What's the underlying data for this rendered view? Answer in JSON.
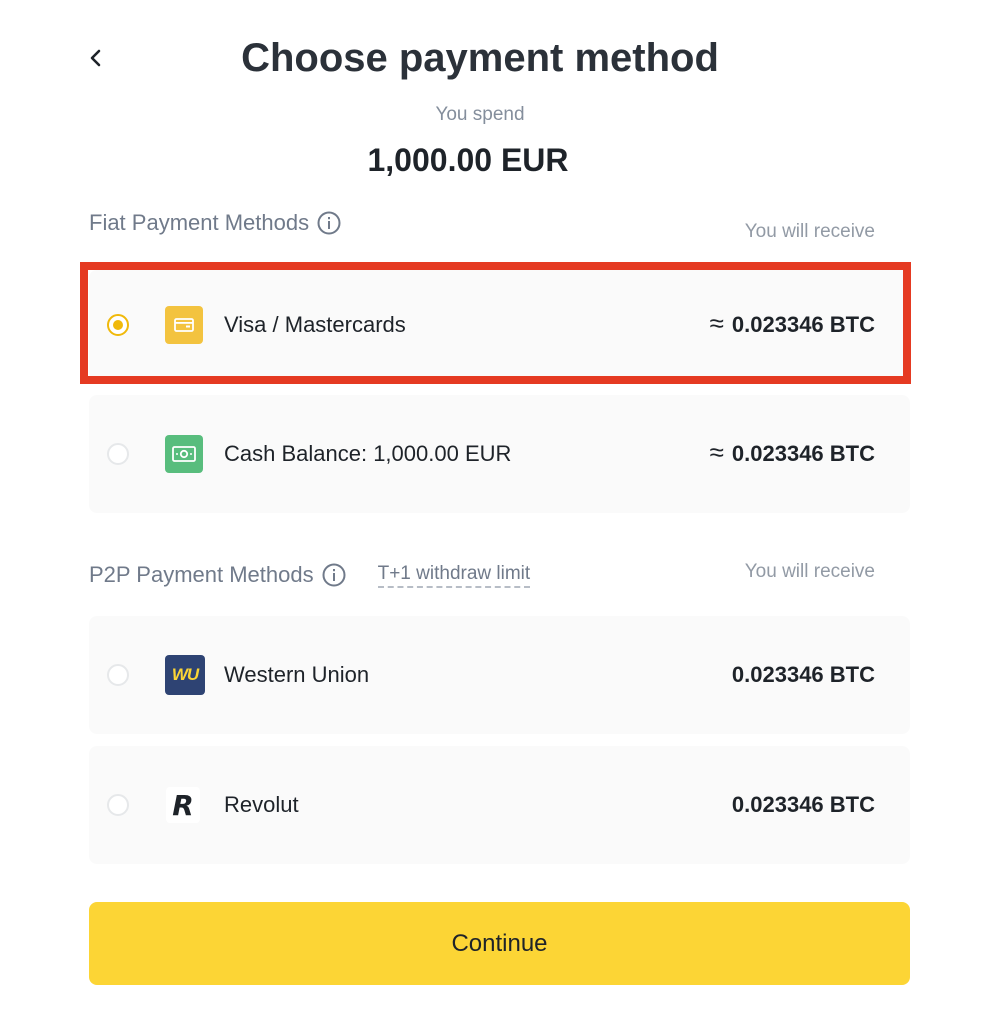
{
  "header": {
    "title": "Choose payment method",
    "spend_label": "You spend",
    "spend_amount": "1,000.00 EUR"
  },
  "fiat_section": {
    "title": "Fiat Payment Methods",
    "receive_label": "You will receive",
    "methods": [
      {
        "name": "Visa / Mastercards",
        "approx": "≈",
        "value": "0.023346 BTC",
        "selected": true,
        "icon": "card-icon",
        "icon_color": "#f0b90b"
      },
      {
        "name": "Cash Balance: 1,000.00 EUR",
        "approx": "≈",
        "value": "0.023346 BTC",
        "selected": false,
        "icon": "cash-icon",
        "icon_color": "#58bd7d"
      }
    ]
  },
  "p2p_section": {
    "title": "P2P Payment Methods",
    "limit_link": "T+1  withdraw limit",
    "receive_label": "You will receive",
    "methods": [
      {
        "name": "Western Union",
        "value": "0.023346 BTC",
        "selected": false,
        "icon": "western-union-logo",
        "icon_text": "WU",
        "icon_color": "#2e4373"
      },
      {
        "name": "Revolut",
        "value": "0.023346 BTC",
        "selected": false,
        "icon": "revolut-logo",
        "icon_text": "R"
      }
    ]
  },
  "continue_label": "Continue",
  "colors": {
    "accent": "#fcd535",
    "radio_selected": "#f0b90b",
    "highlight": "#e53a22"
  }
}
